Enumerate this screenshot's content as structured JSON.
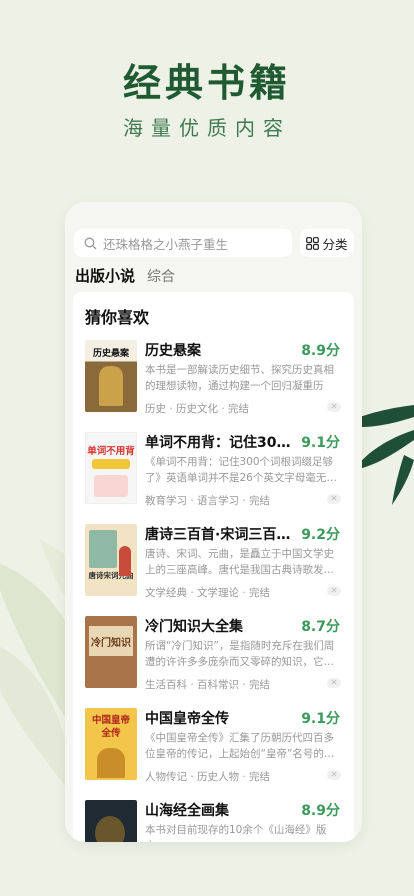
{
  "hero": {
    "title": "经典书籍",
    "subtitle": "海量优质内容"
  },
  "search": {
    "placeholder": "还珠格格之小燕子重生"
  },
  "category_button": {
    "label": "分类"
  },
  "tabs": [
    {
      "label": "出版小说",
      "active": true
    },
    {
      "label": "综合",
      "active": false
    }
  ],
  "section": {
    "title": "猜你喜欢"
  },
  "books": [
    {
      "title": "历史悬案",
      "score": "8.9分",
      "desc": "本书是一部解读历史细节、探究历史真相的理想读物，通过构建一个回归凝重历史…",
      "tags": "历史 · 历史文化 · 完结",
      "cover_text": "历史悬案"
    },
    {
      "title": "单词不用背：记住30…",
      "score": "9.1分",
      "desc": "《单词不用背：记住300个词根词缀足够了》英语单词并不是26个英文字母毫无…",
      "tags": "教育学习 · 语言学习 · 完结",
      "cover_text": "单词不用背"
    },
    {
      "title": "唐诗三百首·宋词三百…",
      "score": "9.2分",
      "desc": "唐诗、宋词、元曲，是矗立于中国文学史上的三座高峰。唐代是我国古典诗歌发…",
      "tags": "文学经典 · 文学理论 · 完结",
      "cover_text": "唐诗宋词元曲"
    },
    {
      "title": "冷门知识大全集",
      "score": "8.7分",
      "desc": "所谓“冷门知识”，是指随时充斥在我们周遭的许许多多庞杂而又零碎的知识，它…",
      "tags": "生活百科 · 百科常识 · 完结",
      "cover_text": "冷门知识"
    },
    {
      "title": "中国皇帝全传",
      "score": "9.1分",
      "desc": "《中国皇帝全传》汇集了历朝历代四百多位皇帝的传记，上起始创“皇帝”名号的…",
      "tags": "人物传记 · 历史人物 · 完结",
      "cover_text": "中国皇帝全传"
    },
    {
      "title": "山海经全画集",
      "score": "8.9分",
      "desc": "本书对目前现存的10余个《山海经》版本…",
      "tags": "",
      "cover_text": ""
    }
  ],
  "colors": {
    "brand_green": "#1f5a32",
    "score_green": "#3b9a5a",
    "background": "#eef1e6"
  }
}
